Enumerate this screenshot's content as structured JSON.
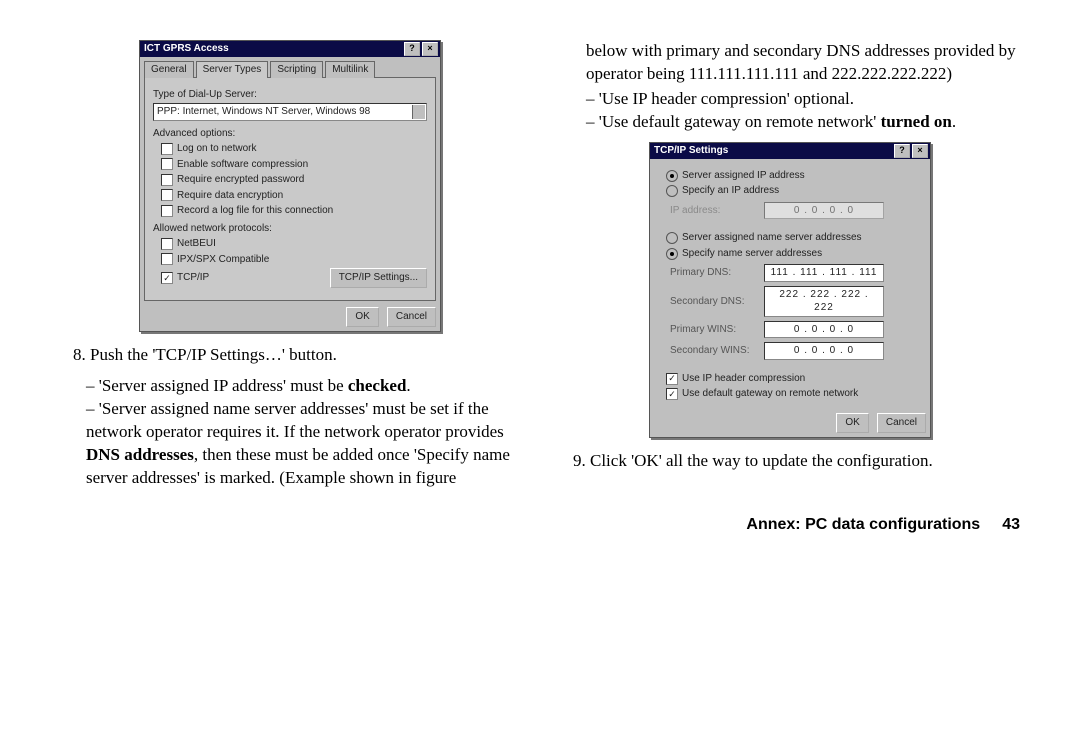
{
  "left": {
    "win": {
      "title": "ICT GPRS Access",
      "tabs": [
        "General",
        "Server Types",
        "Scripting",
        "Multilink"
      ],
      "type_label": "Type of Dial-Up Server:",
      "type_value": "PPP: Internet, Windows NT Server, Windows 98",
      "adv_label": "Advanced options:",
      "adv": [
        "Log on to network",
        "Enable software compression",
        "Require encrypted password",
        "Require data encryption",
        "Record a log file for this connection"
      ],
      "proto_label": "Allowed network protocols:",
      "proto": [
        "NetBEUI",
        "IPX/SPX Compatible",
        "TCP/IP"
      ],
      "tcpip_btn": "TCP/IP Settings...",
      "ok": "OK",
      "cancel": "Cancel"
    },
    "step8": "Push the 'TCP/IP Settings…' button.",
    "b1": "'Server assigned IP address' must be ",
    "b1b": "checked",
    "b1c": ".",
    "b2": "'Server assigned name server addresses' must be set if the network operator requires it. If the network operator provides ",
    "b2b": "DNS addresses",
    "b2c": ", then these must be added once 'Specify name server addresses' is marked. (Example shown in figure"
  },
  "right": {
    "cont": "below with primary and secondary DNS addresses provided by operator being 111.111.111.111 and 222.222.222.222)",
    "b3": "'Use IP header compression' optional.",
    "b4a": "'Use default gateway on remote network' ",
    "b4b": "turned on",
    "b4c": ".",
    "win": {
      "title": "TCP/IP Settings",
      "r1": "Server assigned IP address",
      "r2": "Specify an IP address",
      "ip_label": "IP address:",
      "ip_val": "0 . 0 . 0 . 0",
      "r3": "Server assigned name server addresses",
      "r4": "Specify name server addresses",
      "rows": [
        {
          "l": "Primary DNS:",
          "v": "111 . 111 . 111 . 111"
        },
        {
          "l": "Secondary DNS:",
          "v": "222 . 222 . 222 . 222"
        },
        {
          "l": "Primary WINS:",
          "v": "0 . 0 . 0 . 0"
        },
        {
          "l": "Secondary WINS:",
          "v": "0 . 0 . 0 . 0"
        }
      ],
      "c1": "Use IP header compression",
      "c2": "Use default gateway on remote network",
      "ok": "OK",
      "cancel": "Cancel"
    },
    "step9": "Click 'OK' all the way to update the configuration."
  },
  "footer": {
    "title": "Annex: PC data configurations",
    "page": "43"
  }
}
